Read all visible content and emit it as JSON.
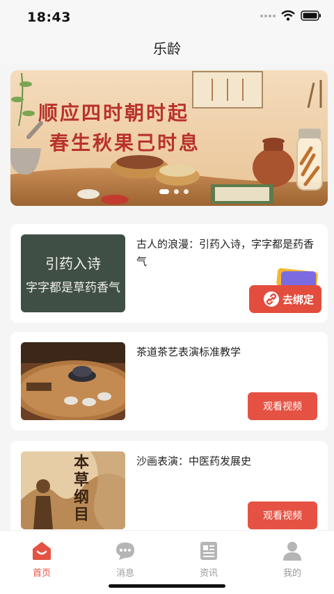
{
  "status_bar": {
    "time": "18:43"
  },
  "header": {
    "title": "乐龄"
  },
  "banner": {
    "line1": "顺应四时朝时起",
    "line2": "春生秋果己时息",
    "slides": 3,
    "active_slide": 0
  },
  "videos": [
    {
      "title": "古人的浪漫：引药入诗，字字都是药香气",
      "thumb_line1": "引药入诗",
      "thumb_line2": "字字都是草药香气",
      "button": "去绑定"
    },
    {
      "title": "茶道茶艺表演标准教学",
      "button": "观看视频"
    },
    {
      "title": "沙画表演：中医药发展史",
      "thumb_text": "本草纲目",
      "button": "观看视频"
    }
  ],
  "tabbar": [
    {
      "label": "首页",
      "icon": "home-icon",
      "active": true
    },
    {
      "label": "消息",
      "icon": "message-icon",
      "active": false
    },
    {
      "label": "资讯",
      "icon": "news-icon",
      "active": false
    },
    {
      "label": "我的",
      "icon": "profile-icon",
      "active": false
    }
  ],
  "colors": {
    "accent": "#e55243",
    "banner_text": "#b8322b",
    "inactive": "#999999"
  }
}
